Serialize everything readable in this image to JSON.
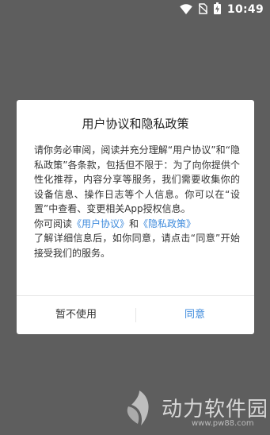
{
  "status_bar": {
    "time": "10:49",
    "icons": [
      "wifi-icon",
      "no-sim-icon",
      "battery-charging-icon"
    ]
  },
  "dialog": {
    "title": "用户协议和隐私政策",
    "para1": "请你务必审阅，阅读并充分理解“用户协议”和“隐私政策”各条款，包括但不限于：为了向你提供个性化推荐，内容分享等服务，我们需要收集你的设备信息、操作日志等个人信息。你可以在“设置”中查看、变更相关App授权信息。",
    "para2_prefix": "你可阅读",
    "user_agreement_link": "《用户协议》",
    "and_text": "和",
    "privacy_policy_link": "《隐私政策》",
    "para3": "了解详细信息后，如你同意，请点击“同意”开始接受我们的服务。",
    "cancel_label": "暂不使用",
    "agree_label": "同意"
  },
  "watermark": {
    "brand": "动力软件园",
    "url": "www.pw88.com"
  }
}
